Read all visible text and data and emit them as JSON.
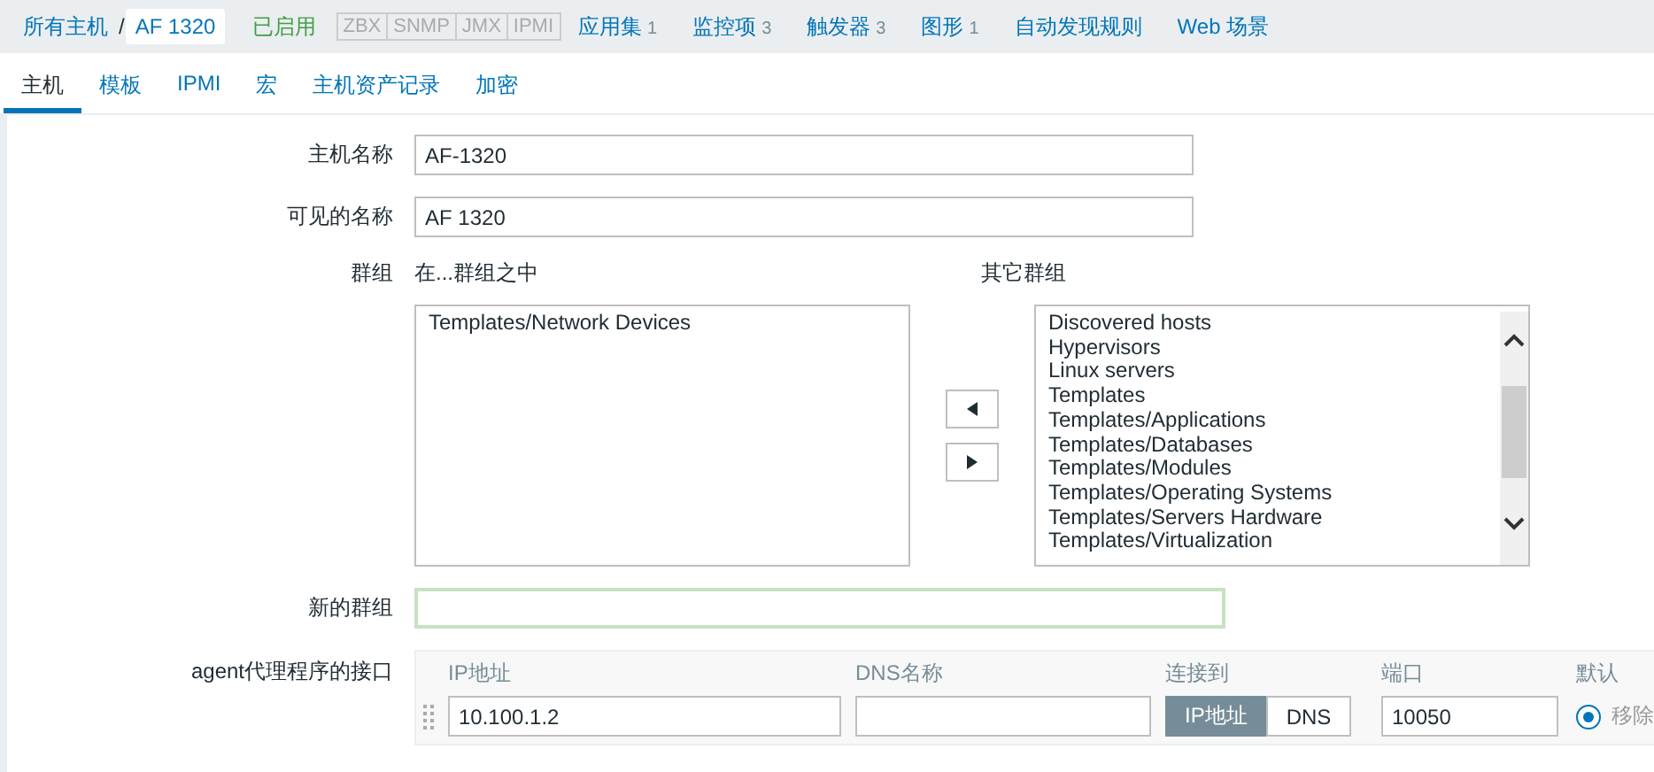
{
  "breadcrumb": {
    "items": [
      {
        "label": "所有主机",
        "current": false
      },
      {
        "label": "AF 1320",
        "current": true
      }
    ],
    "separator": "/"
  },
  "status": {
    "label": "已启用",
    "enabled": true
  },
  "availability": [
    {
      "label": "ZBX",
      "available": false
    },
    {
      "label": "SNMP",
      "available": false
    },
    {
      "label": "JMX",
      "available": false
    },
    {
      "label": "IPMI",
      "available": false
    }
  ],
  "links": [
    {
      "label": "应用集",
      "count": "1"
    },
    {
      "label": "监控项",
      "count": "3"
    },
    {
      "label": "触发器",
      "count": "3"
    },
    {
      "label": "图形",
      "count": "1"
    },
    {
      "label": "自动发现规则"
    },
    {
      "label": "Web 场景"
    }
  ],
  "tabs": [
    {
      "label": "主机",
      "selected": true
    },
    {
      "label": "模板",
      "selected": false
    },
    {
      "label": "IPMI",
      "selected": false
    },
    {
      "label": "宏",
      "selected": false
    },
    {
      "label": "主机资产记录",
      "selected": false
    },
    {
      "label": "加密",
      "selected": false
    }
  ],
  "form": {
    "host_name": {
      "label": "主机名称",
      "value": "AF-1320"
    },
    "visible_name": {
      "label": "可见的名称",
      "value": "AF 1320"
    },
    "groups": {
      "label": "群组",
      "in_title": "在...群组之中",
      "in_groups": [
        "Templates/Network Devices"
      ],
      "other_title": "其它群组",
      "other_groups": [
        "Discovered hosts",
        "Hypervisors",
        "Linux servers",
        "Templates",
        "Templates/Applications",
        "Templates/Databases",
        "Templates/Modules",
        "Templates/Operating Systems",
        "Templates/Servers Hardware",
        "Templates/Virtualization"
      ]
    },
    "new_group": {
      "label": "新的群组",
      "focused": true
    },
    "agent_interface": {
      "label": "agent代理程序的接口",
      "columns": [
        "IP地址",
        "DNS名称",
        "连接到",
        "端口",
        "默认"
      ],
      "row": {
        "ip": "10.100.1.2",
        "connect": [
          {
            "label": "IP地址",
            "selected": true
          },
          {
            "label": "DNS",
            "selected": false
          }
        ],
        "port": "10050",
        "default": true,
        "remove": "移除"
      }
    }
  }
}
